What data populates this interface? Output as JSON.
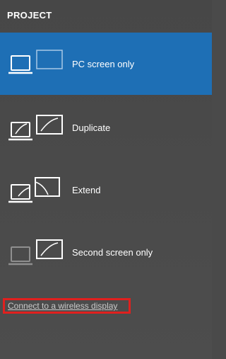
{
  "panel": {
    "title": "PROJECT"
  },
  "options": [
    {
      "label": "PC screen only",
      "icon": "pc-screen-only-icon",
      "selected": true
    },
    {
      "label": "Duplicate",
      "icon": "duplicate-icon",
      "selected": false
    },
    {
      "label": "Extend",
      "icon": "extend-icon",
      "selected": false
    },
    {
      "label": "Second screen only",
      "icon": "second-screen-only-icon",
      "selected": false
    }
  ],
  "wireless": {
    "label": "Connect to a wireless display"
  },
  "colors": {
    "panel_bg": "#4a4a4a",
    "selected_bg": "#1e6fb5",
    "highlight_border": "#e0201e",
    "link_text": "#c9c9c9"
  }
}
